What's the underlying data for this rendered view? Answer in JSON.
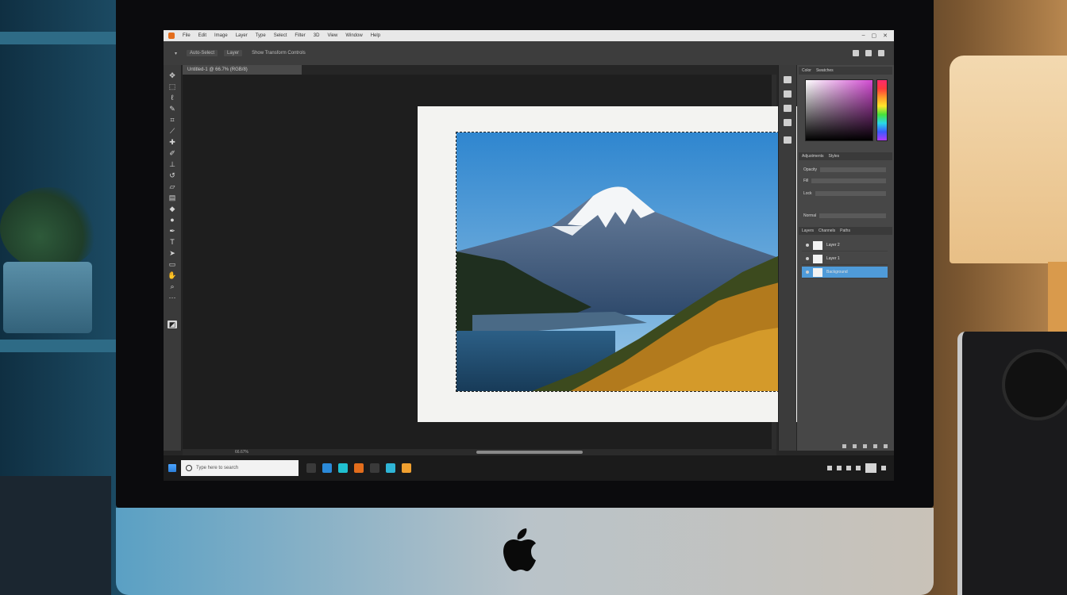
{
  "menubar": {
    "items": [
      "File",
      "Edit",
      "Image",
      "Layer",
      "Type",
      "Select",
      "Filter",
      "3D",
      "View",
      "Window",
      "Help"
    ],
    "window_controls": [
      "–",
      "▢",
      "✕"
    ]
  },
  "options_bar": {
    "items": [
      "▾",
      "Auto-Select",
      "Layer",
      "Show Transform Controls"
    ]
  },
  "document": {
    "tab_label": "Untitled-1 @ 66.7% (RGB/8)",
    "zoom": "66.67%"
  },
  "toolbox": {
    "tools": [
      "move-tool",
      "marquee-tool",
      "lasso-tool",
      "quick-select-tool",
      "crop-tool",
      "eyedropper-tool",
      "healing-tool",
      "brush-tool",
      "clone-stamp-tool",
      "history-brush-tool",
      "eraser-tool",
      "gradient-tool",
      "blur-tool",
      "dodge-tool",
      "pen-tool",
      "type-tool",
      "path-select-tool",
      "shape-tool",
      "hand-tool",
      "zoom-tool",
      "color-swatch"
    ]
  },
  "panels": {
    "color_tabs": [
      "Color",
      "Swatches"
    ],
    "properties_tabs": [
      "Adjustments",
      "Styles"
    ],
    "property_rows": [
      "Opacity",
      "Fill",
      "Lock",
      "Normal"
    ],
    "layers_tabs": [
      "Layers",
      "Channels",
      "Paths"
    ],
    "layers": [
      {
        "name": "Layer 2",
        "selected": false
      },
      {
        "name": "Layer 1",
        "selected": false
      },
      {
        "name": "Background",
        "selected": true
      }
    ],
    "accent": "#4f9bd9"
  },
  "taskbar": {
    "search_placeholder": "Type here to search",
    "app_colors": [
      "#3a3a3a",
      "#2b8ad9",
      "#20c0d0",
      "#e36d1c",
      "#3a3a3a",
      "#2fb5d6",
      "#f0a030"
    ]
  }
}
